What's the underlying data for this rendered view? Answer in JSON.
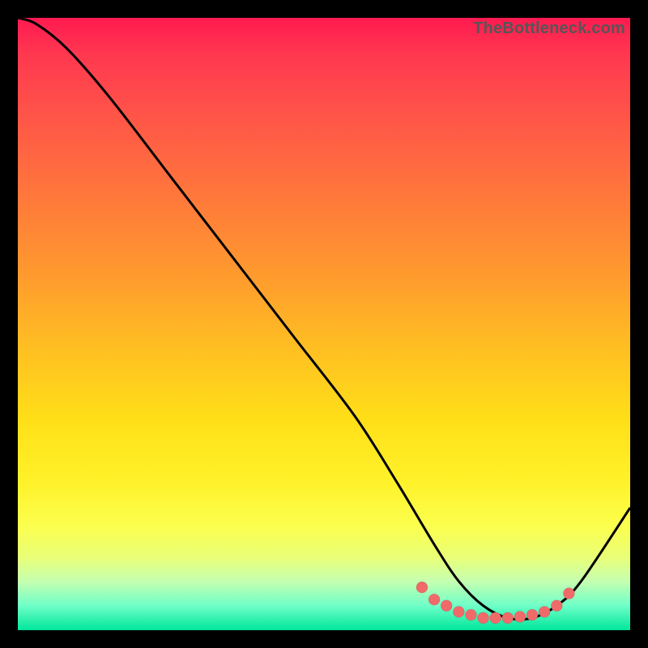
{
  "watermark": "TheBottleneck.com",
  "colors": {
    "background": "#000000",
    "curve": "#000000",
    "marker": "#f16a6a",
    "gradient_top": "#ff1a50",
    "gradient_bottom": "#00e69b"
  },
  "chart_data": {
    "type": "line",
    "title": "",
    "xlabel": "",
    "ylabel": "",
    "xlim": [
      0,
      100
    ],
    "ylim": [
      0,
      100
    ],
    "series": [
      {
        "name": "bottleneck-curve",
        "x": [
          0,
          3,
          8,
          15,
          25,
          35,
          45,
          55,
          62,
          68,
          72,
          76,
          80,
          84,
          88,
          92,
          100
        ],
        "y": [
          100,
          99,
          95,
          87,
          74,
          61,
          48,
          35,
          24,
          14,
          8,
          4,
          2,
          2,
          4,
          8,
          20
        ]
      }
    ],
    "markers": {
      "name": "optimal-range-dots",
      "x": [
        66,
        68,
        70,
        72,
        74,
        76,
        78,
        80,
        82,
        84,
        86,
        88,
        90
      ],
      "y": [
        7,
        5,
        4,
        3,
        2.5,
        2,
        2,
        2,
        2.2,
        2.5,
        3,
        4,
        6
      ]
    },
    "note": "Values are relative percentages read from an unlabeled gradient chart; y is distance from the bottom (0 = bottom green, 100 = top red). The curve descends steeply from top-left, flattens near x≈75–85 at the bottom, then rises toward the right. Salmon dots mark the flat optimal region."
  }
}
